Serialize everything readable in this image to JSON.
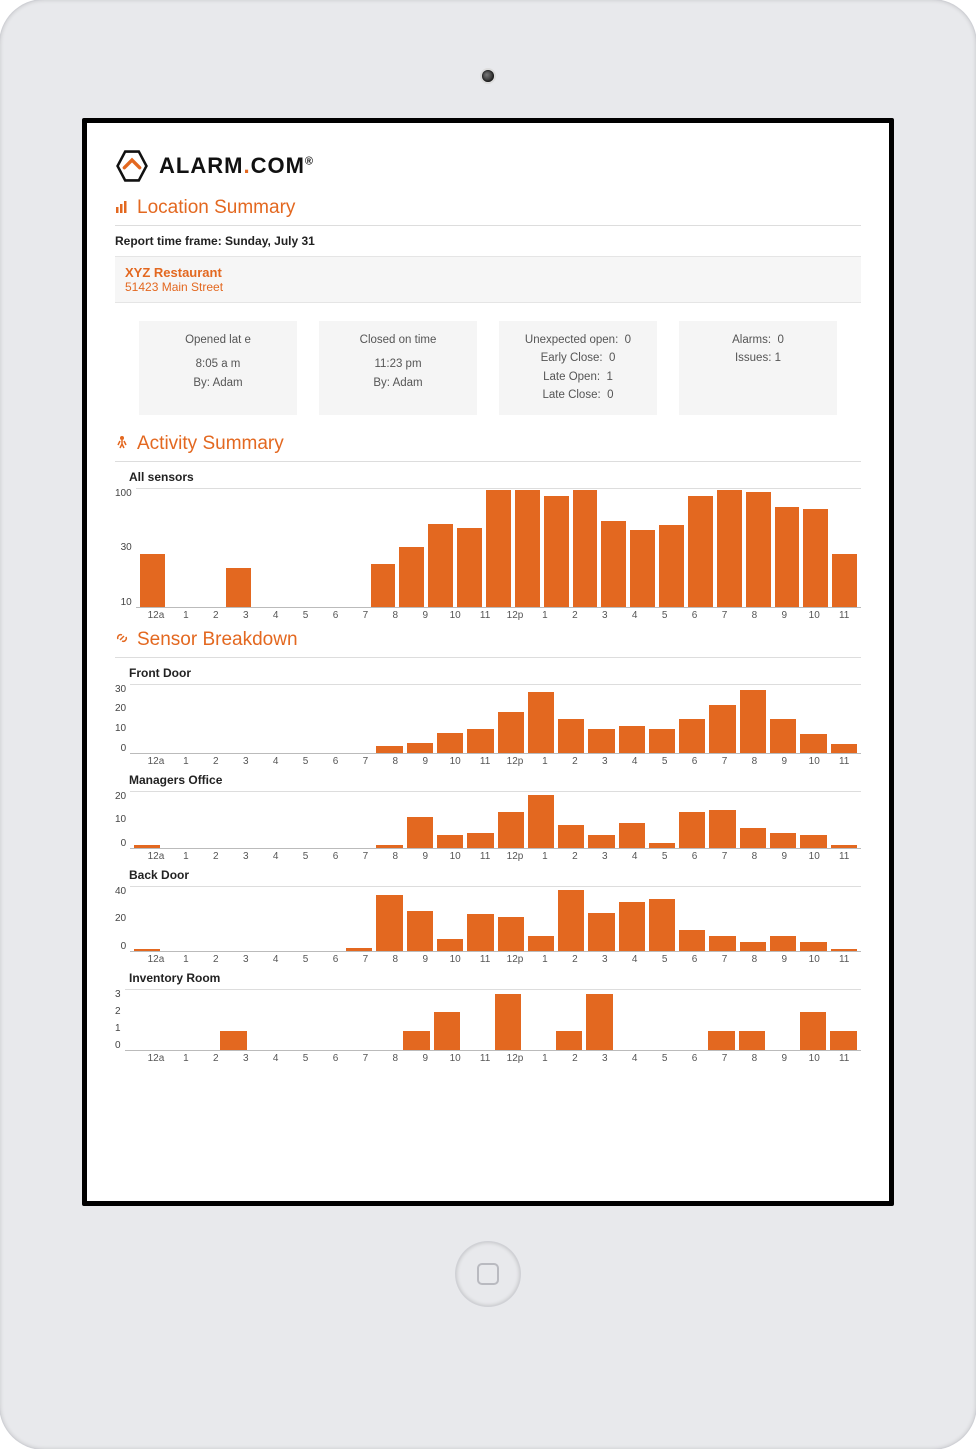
{
  "brand": {
    "name_left": "ALARM",
    "dot": ".",
    "name_right": "COM",
    "trademark": "®"
  },
  "location_summary": {
    "title": "Location Summary",
    "report_frame_label": "Report time frame: Sunday, July 31",
    "location_name": "XYZ Restaurant",
    "location_addr": "51423 Main Street"
  },
  "cards": {
    "open": {
      "header": "Opened lat e",
      "time": "8:05 a m",
      "by": "By: Adam"
    },
    "close": {
      "header": "Closed on time",
      "time": "11:23 pm",
      "by": "By: Adam"
    },
    "ops": {
      "unexpected_open_label": "Unexpected open:",
      "unexpected_open_val": "0",
      "early_close_label": "Early Close:",
      "early_close_val": "0",
      "late_open_label": "Late Open:",
      "late_open_val": "1",
      "late_close_label": "Late Close:",
      "late_close_val": "0"
    },
    "alarms": {
      "alarms_label": "Alarms:",
      "alarms_val": "0",
      "issues_label": "Issues:",
      "issues_val": "1"
    }
  },
  "activity_title": "Activity Summary",
  "sensor_title": "Sensor Breakdown",
  "x_labels": [
    "12a",
    "1",
    "2",
    "3",
    "4",
    "5",
    "6",
    "7",
    "8",
    "9",
    "10",
    "11",
    "12p",
    "1",
    "2",
    "3",
    "4",
    "5",
    "6",
    "7",
    "8",
    "9",
    "10",
    "11"
  ],
  "charts": {
    "all_sensors": {
      "label": "All sensors",
      "y_ticks": [
        "100",
        "30",
        "10"
      ],
      "values": [
        9,
        1,
        1,
        5,
        1,
        1,
        1,
        1,
        6,
        12,
        32,
        27,
        130,
        130,
        100,
        130,
        35,
        25,
        30,
        100,
        130,
        120,
        65,
        60,
        9
      ]
    },
    "front_door": {
      "label": "Front Door",
      "y_ticks": [
        "30",
        "20",
        "10",
        "0"
      ],
      "values": [
        0,
        0,
        0,
        0,
        0,
        0,
        0,
        0,
        4,
        6,
        12,
        14,
        24,
        36,
        20,
        14,
        16,
        14,
        20,
        28,
        37,
        20,
        11,
        5
      ]
    },
    "managers_office": {
      "label": "Managers Office",
      "y_ticks": [
        "20",
        "10",
        "0"
      ],
      "values": [
        1,
        0,
        0,
        0,
        0,
        0,
        0,
        0,
        1,
        12,
        5,
        6,
        14,
        21,
        9,
        5,
        10,
        2,
        14,
        15,
        8,
        6,
        5,
        1
      ]
    },
    "back_door": {
      "label": "Back Door",
      "y_ticks": [
        "40",
        "20",
        "0"
      ],
      "values": [
        1,
        0,
        0,
        0,
        0,
        0,
        0,
        2,
        37,
        26,
        8,
        24,
        22,
        10,
        40,
        25,
        32,
        34,
        14,
        10,
        6,
        10,
        6,
        1
      ]
    },
    "inventory_room": {
      "label": "Inventory Room",
      "y_ticks": [
        "3",
        "2",
        "1",
        "0"
      ],
      "values": [
        0,
        0,
        0,
        1,
        0,
        0,
        0,
        0,
        0,
        1,
        2,
        0,
        3,
        0,
        1,
        3,
        0,
        0,
        0,
        1,
        1,
        0,
        2,
        1
      ]
    }
  },
  "chart_data": [
    {
      "type": "bar",
      "title": "All sensors",
      "categories": [
        "12a",
        "1",
        "2",
        "3",
        "4",
        "5",
        "6",
        "7",
        "8",
        "9",
        "10",
        "11",
        "12p",
        "1",
        "2",
        "3",
        "4",
        "5",
        "6",
        "7",
        "8",
        "9",
        "10",
        "11"
      ],
      "values": [
        9,
        1,
        1,
        5,
        1,
        1,
        1,
        1,
        6,
        12,
        32,
        27,
        130,
        130,
        100,
        130,
        35,
        25,
        30,
        100,
        130,
        120,
        65,
        60,
        9
      ],
      "yscale": "log",
      "yticks": [
        10,
        30,
        100
      ],
      "xlabel": "",
      "ylabel": ""
    },
    {
      "type": "bar",
      "title": "Front Door",
      "categories": [
        "12a",
        "1",
        "2",
        "3",
        "4",
        "5",
        "6",
        "7",
        "8",
        "9",
        "10",
        "11",
        "12p",
        "1",
        "2",
        "3",
        "4",
        "5",
        "6",
        "7",
        "8",
        "9",
        "10",
        "11"
      ],
      "values": [
        0,
        0,
        0,
        0,
        0,
        0,
        0,
        0,
        4,
        6,
        12,
        14,
        24,
        36,
        20,
        14,
        16,
        14,
        20,
        28,
        37,
        20,
        11,
        5
      ],
      "ylim": [
        0,
        40
      ],
      "xlabel": "",
      "ylabel": ""
    },
    {
      "type": "bar",
      "title": "Managers Office",
      "categories": [
        "12a",
        "1",
        "2",
        "3",
        "4",
        "5",
        "6",
        "7",
        "8",
        "9",
        "10",
        "11",
        "12p",
        "1",
        "2",
        "3",
        "4",
        "5",
        "6",
        "7",
        "8",
        "9",
        "10",
        "11"
      ],
      "values": [
        1,
        0,
        0,
        0,
        0,
        0,
        0,
        0,
        1,
        12,
        5,
        6,
        14,
        21,
        9,
        5,
        10,
        2,
        14,
        15,
        8,
        6,
        5,
        1
      ],
      "ylim": [
        0,
        22
      ],
      "xlabel": "",
      "ylabel": ""
    },
    {
      "type": "bar",
      "title": "Back Door",
      "categories": [
        "12a",
        "1",
        "2",
        "3",
        "4",
        "5",
        "6",
        "7",
        "8",
        "9",
        "10",
        "11",
        "12p",
        "1",
        "2",
        "3",
        "4",
        "5",
        "6",
        "7",
        "8",
        "9",
        "10",
        "11"
      ],
      "values": [
        1,
        0,
        0,
        0,
        0,
        0,
        0,
        2,
        37,
        26,
        8,
        24,
        22,
        10,
        40,
        25,
        32,
        34,
        14,
        10,
        6,
        10,
        6,
        1
      ],
      "ylim": [
        0,
        42
      ],
      "xlabel": "",
      "ylabel": ""
    },
    {
      "type": "bar",
      "title": "Inventory Room",
      "categories": [
        "12a",
        "1",
        "2",
        "3",
        "4",
        "5",
        "6",
        "7",
        "8",
        "9",
        "10",
        "11",
        "12p",
        "1",
        "2",
        "3",
        "4",
        "5",
        "6",
        "7",
        "8",
        "9",
        "10",
        "11"
      ],
      "values": [
        0,
        0,
        0,
        1,
        0,
        0,
        0,
        0,
        0,
        1,
        2,
        0,
        3,
        0,
        1,
        3,
        0,
        0,
        0,
        1,
        1,
        0,
        2,
        1
      ],
      "ylim": [
        0,
        3.2
      ],
      "xlabel": "",
      "ylabel": ""
    }
  ]
}
